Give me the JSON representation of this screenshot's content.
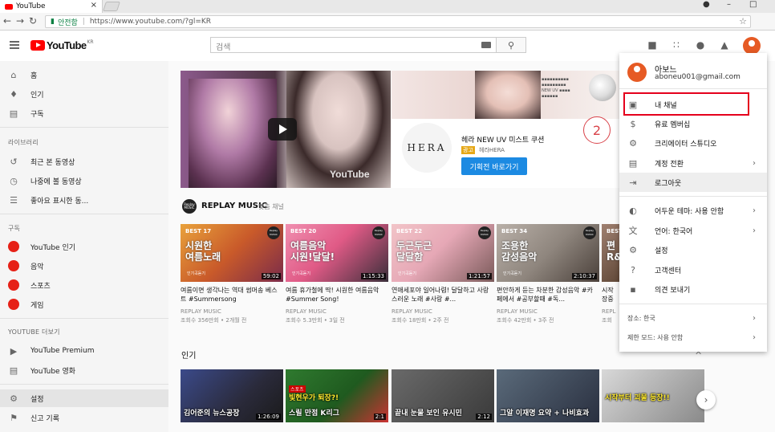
{
  "browser": {
    "tab_title": "YouTube",
    "tab_close": "×",
    "win_controls": [
      "–",
      "□"
    ],
    "secure_label": "안전함",
    "url": "https://www.youtube.com/?gl=KR"
  },
  "header": {
    "logo_text": "YouTube",
    "logo_region": "KR",
    "search_placeholder": "검색"
  },
  "sidebar": {
    "top": [
      {
        "label": "홈",
        "icon": "home-icon"
      },
      {
        "label": "인기",
        "icon": "flame-icon"
      },
      {
        "label": "구독",
        "icon": "subscriptions-icon"
      }
    ],
    "library_heading": "라이브러리",
    "library": [
      {
        "label": "최근 본 동영상",
        "icon": "history-icon"
      },
      {
        "label": "나중에 볼 동영상",
        "icon": "clock-icon"
      },
      {
        "label": "좋아요 표시한 동...",
        "icon": "playlist-icon"
      }
    ],
    "subs_heading": "구독",
    "subs": [
      {
        "label": "YouTube 인기",
        "color": "#e62117"
      },
      {
        "label": "음악",
        "color": "#e62117"
      },
      {
        "label": "스포츠",
        "color": "#e62117"
      },
      {
        "label": "게임",
        "color": "#e62117"
      }
    ],
    "more_heading": "YOUTUBE 더보기",
    "more": [
      {
        "label": "YouTube Premium",
        "icon": "youtube-icon"
      },
      {
        "label": "YouTube 영화",
        "icon": "film-icon"
      }
    ],
    "bottom": [
      {
        "label": "설정",
        "icon": "gear-icon"
      },
      {
        "label": "신고 기록",
        "icon": "flag-icon"
      }
    ]
  },
  "ad": {
    "watermark": "YouTube",
    "brand_text": "HERA",
    "title": "헤라 NEW UV 미스트 쿠션",
    "badge": "광고",
    "sub": "헤라HERA",
    "button": "기획전 바로가기"
  },
  "shelf": {
    "avatar_text": "Replay MUSIC",
    "title": "REPLAY MUSIC",
    "subtitle": "맞춤 채널",
    "videos": [
      {
        "best": "BEST 17",
        "big": "시원한\n여름노래",
        "small": "인기곡듣기",
        "duration": "59:02",
        "title": "여름이면 생각나는 역대 썸머송 베스트 #Summersong",
        "channel": "REPLAY MUSIC",
        "meta": "조회수 356만회 • 2개월 전",
        "bg": "linear-gradient(135deg,#e9a23b 0%,#c95a2a 50%,#7a2b4a 100%)"
      },
      {
        "best": "BEST 20",
        "big": "여름음악\n시원!달달!",
        "small": "인기곡듣기",
        "duration": "1:15:33",
        "title": "여름 휴가철에 딱! 시원한 여름음악 #Summer Song!",
        "channel": "REPLAY MUSIC",
        "meta": "조회수 5.3만회 • 3일 전",
        "bg": "linear-gradient(135deg,#f08fb0 0%,#e05a86 45%,#3a2f3a 100%)"
      },
      {
        "best": "BEST 22",
        "big": "두근두근\n달달함",
        "small": "인기곡듣기",
        "duration": "1:21:57",
        "title": "연애세포야 일어나렴! 달달하고 사랑스러운 노래 #사랑 #...",
        "channel": "REPLAY MUSIC",
        "meta": "조회수 18만회 • 2주 전",
        "bg": "linear-gradient(135deg,#f2c4c8 0%,#e6a8b6 45%,#7a5a5a 100%)"
      },
      {
        "best": "BEST 34",
        "big": "조용한\n감성음악",
        "small": "인기곡듣기",
        "duration": "2:10:37",
        "title": "편안하게 듣는 차분한 감성음악 #카페에서 #공부할때 #독...",
        "channel": "REPLAY MUSIC",
        "meta": "조회수 42만회 • 3주 전",
        "bg": "linear-gradient(135deg,#b9b0a8 0%,#8f867e 50%,#4a403a 100%)"
      },
      {
        "best": "BEST",
        "big": "편\nR&",
        "small": "",
        "duration": "",
        "title": "시작\n장중",
        "channel": "REPL",
        "meta": "조회",
        "bg": "linear-gradient(135deg,#a08070 0%,#604838 100%)"
      }
    ]
  },
  "popular": {
    "heading": "인기",
    "videos": [
      {
        "tag": "",
        "cap2": "",
        "cap": "김어준의 뉴스공장",
        "duration": "1:26:09",
        "bg": "linear-gradient(135deg,#3b4a8a 0%,#2a2a3a 60%,#1a1a1a 100%)"
      },
      {
        "tag": "스포츠",
        "cap2": "빛현우가 퇴장?!",
        "cap": "스릴 만점 K리그",
        "duration": "2:1",
        "bg": "linear-gradient(135deg,#2f7a2f 0%,#1f5a1f 55%,#c33 100%)"
      },
      {
        "tag": "",
        "cap2": "",
        "cap": "끝내 눈물 보인 유시민",
        "duration": "2:12",
        "bg": "linear-gradient(135deg,#6a6a6a 0%,#3a3a3a 100%)"
      },
      {
        "tag": "",
        "cap2": "",
        "cap": "그알 이재명 요약 + 나비효과",
        "duration": "",
        "bg": "linear-gradient(135deg,#5a6a7a 0%,#2a3040 100%)"
      },
      {
        "tag": "",
        "cap2": "시작부터 괴물 등장!!",
        "cap": "",
        "duration": "",
        "bg": "linear-gradient(135deg,#d8d8d8 0%,#8a8a8a 100%)"
      }
    ],
    "close": "✕"
  },
  "menu": {
    "name": "아보느",
    "email": "aboneu001@gmail.com",
    "items": [
      {
        "label": "내 채널",
        "icon": "person-icon",
        "chev": ""
      },
      {
        "label": "유료 멤버십",
        "icon": "dollar-icon",
        "chev": ""
      },
      {
        "label": "크리에이터 스튜디오",
        "icon": "gear-icon",
        "chev": ""
      },
      {
        "label": "계정 전환",
        "icon": "switch-account-icon",
        "chev": "›"
      },
      {
        "label": "로그아웃",
        "icon": "logout-icon",
        "chev": ""
      }
    ],
    "items2": [
      {
        "label": "어두운 테마: 사용 안함",
        "icon": "dark-theme-icon",
        "chev": "›"
      },
      {
        "label": "언어: 한국어",
        "icon": "translate-icon",
        "chev": "›"
      },
      {
        "label": "설정",
        "icon": "gear-icon",
        "chev": ""
      },
      {
        "label": "고객센터",
        "icon": "help-icon",
        "chev": ""
      },
      {
        "label": "의견 보내기",
        "icon": "feedback-icon",
        "chev": ""
      }
    ],
    "items3": [
      {
        "label": "장소: 한국",
        "chev": "›"
      },
      {
        "label": "제한 모드: 사용 안함",
        "chev": "›"
      }
    ]
  },
  "annotation": {
    "step": "2"
  }
}
